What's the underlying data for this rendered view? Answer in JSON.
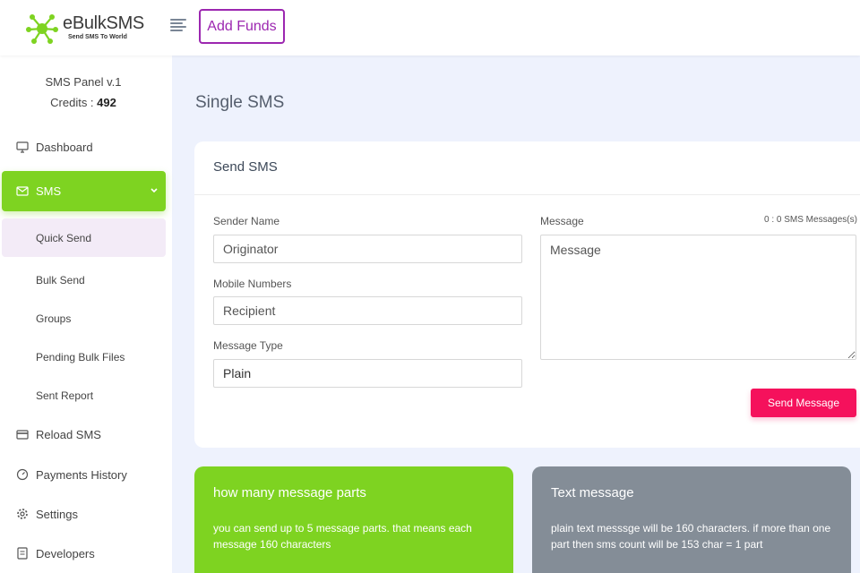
{
  "header": {
    "brand_name": "eBulkSMS",
    "brand_tagline": "Send SMS To World",
    "add_funds_label": "Add Funds",
    "accent_color": "#9c27b0"
  },
  "sidebar": {
    "panel_name": "SMS Panel v.1",
    "credits_label": "Credits : ",
    "credits_value": "492",
    "items": [
      {
        "label": "Dashboard",
        "icon": "monitor-icon"
      },
      {
        "label": "SMS",
        "icon": "mail-icon",
        "active": true,
        "color": "#7ed321"
      },
      {
        "label": "Reload SMS",
        "icon": "card-icon"
      },
      {
        "label": "Payments History",
        "icon": "gauge-icon"
      },
      {
        "label": "Settings",
        "icon": "gear-icon"
      },
      {
        "label": "Developers",
        "icon": "document-icon"
      }
    ],
    "sms_subitems": [
      {
        "label": "Quick Send",
        "selected": true
      },
      {
        "label": "Bulk Send"
      },
      {
        "label": "Groups"
      },
      {
        "label": "Pending Bulk Files"
      },
      {
        "label": "Sent Report"
      }
    ]
  },
  "main": {
    "page_title": "Single SMS",
    "form": {
      "card_title": "Send SMS",
      "sender_label": "Sender Name",
      "sender_placeholder": "Originator",
      "mobile_label": "Mobile Numbers",
      "mobile_placeholder": "Recipient",
      "type_label": "Message Type",
      "type_value": "Plain",
      "message_label": "Message",
      "message_count": "0 : 0 SMS Messages(s)",
      "message_placeholder": "Message",
      "send_label": "Send Message",
      "send_color": "#f5115c"
    },
    "info_cards": [
      {
        "title": "how many message parts",
        "body": "you can send up to 5 message parts. that means each message 160 characters",
        "color": "#7ed321"
      },
      {
        "title": "Text message",
        "body": "plain text messsge will be 160 characters. if more than one part then sms count will be 153 char = 1 part",
        "color": "#848d97"
      }
    ]
  }
}
